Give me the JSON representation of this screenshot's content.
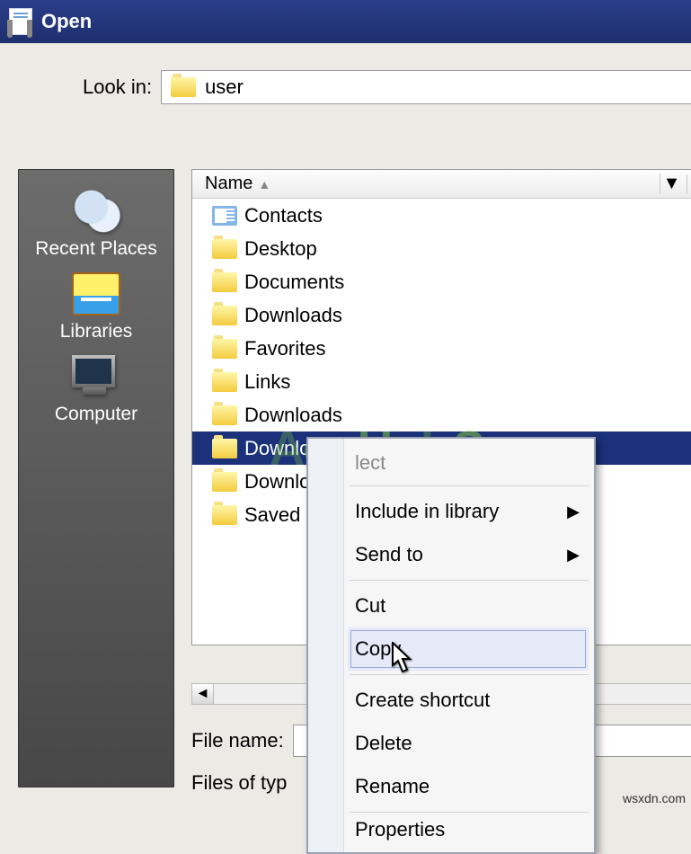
{
  "window": {
    "title": "Open"
  },
  "lookin": {
    "label": "Look in:",
    "value": "user"
  },
  "sidebar": {
    "items": [
      {
        "label": "Recent Places"
      },
      {
        "label": "Libraries"
      },
      {
        "label": "Computer"
      }
    ]
  },
  "list": {
    "header": {
      "name_col": "Name"
    },
    "rows": [
      {
        "name": "Contacts",
        "icon": "contacts-icon"
      },
      {
        "name": "Desktop",
        "icon": "folder-icon"
      },
      {
        "name": "Documents",
        "icon": "folder-icon"
      },
      {
        "name": "Downloads",
        "icon": "folder-icon"
      },
      {
        "name": "Favorites",
        "icon": "folder-icon"
      },
      {
        "name": "Links",
        "icon": "folder-icon"
      },
      {
        "name": "Downloads",
        "icon": "folder-icon"
      },
      {
        "name": "Downloads",
        "icon": "folder-icon",
        "selected": true
      },
      {
        "name": "Downloads",
        "icon": "folder-icon"
      },
      {
        "name": "Saved",
        "icon": "folder-icon"
      }
    ]
  },
  "bottom": {
    "filename_label": "File name:",
    "filetype_label": "Files of typ"
  },
  "contextMenu": {
    "items": [
      {
        "label": "lect",
        "partial_top": true
      },
      {
        "label": "Include in library",
        "has_sub": true,
        "sep_before": true
      },
      {
        "label": "Send to",
        "has_sub": true
      },
      {
        "label": "Cut",
        "sep_before": true
      },
      {
        "label": "Copy",
        "highlight": true
      },
      {
        "label": "Create shortcut",
        "sep_before": true
      },
      {
        "label": "Delete"
      },
      {
        "label": "Rename"
      },
      {
        "label": "Properties",
        "sep_before": true,
        "partial_bottom": true
      }
    ]
  },
  "footer": {
    "source": "wsxdn.com"
  }
}
